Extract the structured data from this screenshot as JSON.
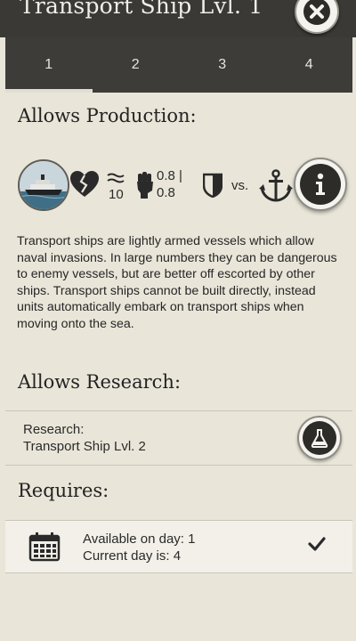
{
  "header": {
    "title": "Transport Ship Lvl. 1"
  },
  "tabs": [
    {
      "label": "1"
    },
    {
      "label": "2"
    },
    {
      "label": "3"
    },
    {
      "label": "4"
    }
  ],
  "production": {
    "title": "Allows Production:",
    "stats": {
      "movement": "10",
      "strength": "0.8 |",
      "strength_2": "0.8",
      "vs_label": "vs."
    },
    "description": "Transport ships are lightly armed vessels which allow naval invasions. In large numbers they can be dangerous to enemy vessels, but are better off escorted by other ships. Transport ships cannot be built directly, instead units automatically embark on transport ships when moving onto the sea."
  },
  "research": {
    "title": "Allows Research:",
    "item_label": "Research:",
    "item_name": "Transport Ship Lvl. 2"
  },
  "requires": {
    "title": "Requires:",
    "available": "Available on day: 1",
    "current": "Current day is: 4"
  },
  "icons": {
    "close": "close-icon",
    "portrait": "transport-ship-portrait",
    "broken_heart": "broken-heart-icon",
    "waves": "waves-icon",
    "fist": "fist-icon",
    "shield": "shield-icon",
    "anchor": "anchor-icon",
    "info": "info-icon",
    "flask": "flask-icon",
    "calendar": "calendar-icon",
    "check": "checkmark-icon"
  },
  "colors": {
    "header_bg": "#3a3936",
    "tab_bg": "#3d3c38",
    "panel_bg": "#e9e6d9",
    "row_highlight": "#f2f0e8"
  }
}
